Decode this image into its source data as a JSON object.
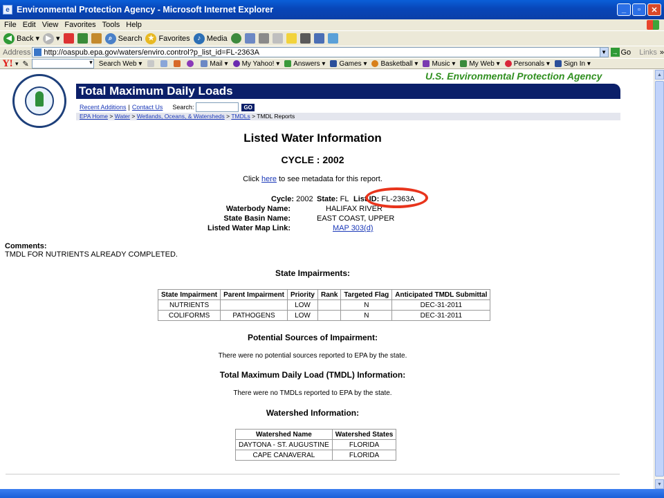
{
  "window": {
    "title": "Environmental Protection Agency - Microsoft Internet Explorer"
  },
  "menu": [
    "File",
    "Edit",
    "View",
    "Favorites",
    "Tools",
    "Help"
  ],
  "toolbar": {
    "back": "Back",
    "search": "Search",
    "favorites": "Favorites",
    "media": "Media"
  },
  "address": {
    "label": "Address",
    "url": "http://oaspub.epa.gov/waters/enviro.control?p_list_id=FL-2363A",
    "go": "Go",
    "links": "Links"
  },
  "yahoo": {
    "logo": "Y!",
    "search_web": "Search Web",
    "items": [
      "Mail",
      "My Yahoo!",
      "Answers",
      "Games",
      "Basketball",
      "Music",
      "My Web",
      "Personals",
      "Sign In"
    ]
  },
  "page": {
    "agency": "U.S. Environmental Protection Agency",
    "logo_text": "UNITED STATES · ENVIRONMENTAL PROTECTION AGENCY",
    "banner": "Total Maximum Daily Loads",
    "util": {
      "recent": "Recent Additions",
      "contact": "Contact Us",
      "search_label": "Search:",
      "go": "GO"
    },
    "breadcrumb": [
      "EPA Home",
      "Water",
      "Wetlands, Oceans, & Watersheds",
      "TMDLs",
      "TMDL Reports"
    ],
    "heading": "Listed Water Information",
    "cycle_heading": "CYCLE : 2002",
    "metadata": {
      "prefix": "Click",
      "link": "here",
      "suffix": "to see metadata for this report."
    },
    "summary": {
      "cycle_label": "Cycle:",
      "cycle_value": "2002",
      "state_label": "State:",
      "state_value": "FL",
      "list_id_label": "List ID:",
      "list_id_value": "FL-2363A",
      "waterbody_label": "Waterbody Name:",
      "waterbody_value": "HALIFAX RIVER",
      "basin_label": "State Basin Name:",
      "basin_value": "EAST COAST, UPPER",
      "map_label": "Listed Water Map Link:",
      "map_value": "MAP 303(d)"
    },
    "comments": {
      "label": "Comments:",
      "text": "TMDL FOR NUTRIENTS ALREADY COMPLETED."
    },
    "impairments": {
      "heading": "State Impairments:",
      "columns": [
        "State Impairment",
        "Parent Impairment",
        "Priority",
        "Rank",
        "Targeted Flag",
        "Anticipated TMDL Submittal"
      ],
      "rows": [
        [
          "NUTRIENTS",
          "",
          "LOW",
          "",
          "N",
          "DEC-31-2011"
        ],
        [
          "COLIFORMS",
          "PATHOGENS",
          "LOW",
          "",
          "N",
          "DEC-31-2011"
        ]
      ]
    },
    "sources": {
      "heading": "Potential Sources of Impairment:",
      "text": "There were no potential sources reported to EPA by the state."
    },
    "tmdl": {
      "heading": "Total Maximum Daily Load (TMDL) Information:",
      "text": "There were no TMDLs reported to EPA by the state."
    },
    "watershed": {
      "heading": "Watershed Information:",
      "columns": [
        "Watershed Name",
        "Watershed States"
      ],
      "rows": [
        [
          "DAYTONA - ST. AUGUSTINE",
          "FLORIDA"
        ],
        [
          "CAPE CANAVERAL",
          "FLORIDA"
        ]
      ]
    }
  },
  "colors": {
    "banner": "#0b1f69",
    "agency_green": "#2f8f1f",
    "highlight_circle": "#e8341c",
    "link": "#1a38b8"
  }
}
